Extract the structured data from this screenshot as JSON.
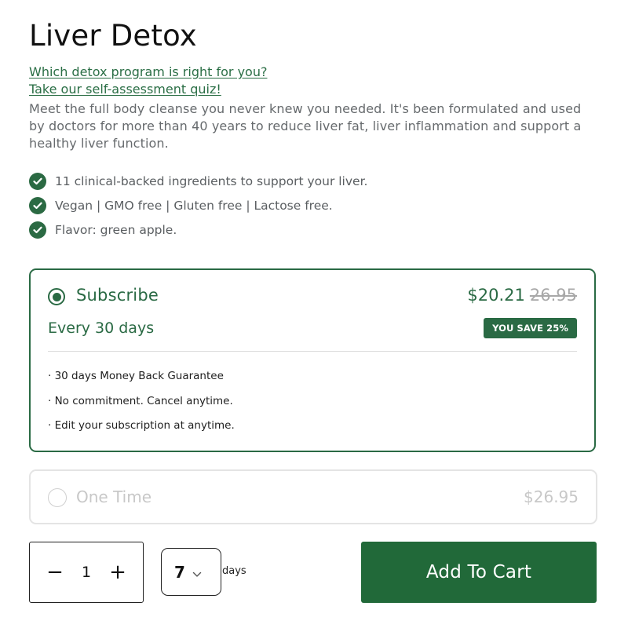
{
  "product": {
    "title": "Liver Detox",
    "quiz_link_1": "Which detox program is right for you?",
    "quiz_link_2": "Take our self-assessment quiz!",
    "description": "Meet the full body cleanse you never knew you needed. It's been formulated and used by doctors for more than 40 years to reduce liver fat, liver inflammation and support a healthy liver function.",
    "features": [
      "11 clinical-backed ingredients to support your liver.",
      "Vegan | GMO free | Gluten free | Lactose free.",
      "Flavor: green apple."
    ]
  },
  "plans": {
    "subscribe": {
      "label": "Subscribe",
      "price": "$20.21",
      "old_price": "26.95",
      "frequency": "Every 30 days",
      "badge": "YOU SAVE 25%",
      "selected": true,
      "perks": [
        "· 30 days Money Back Guarantee",
        "· No commitment. Cancel anytime.",
        "· Edit your subscription at anytime."
      ]
    },
    "one_time": {
      "label": "One Time",
      "price": "$26.95",
      "selected": false
    }
  },
  "purchase": {
    "quantity": "1",
    "decrement_label": "−",
    "increment_label": "+",
    "days_value": "7",
    "days_label": "days",
    "add_to_cart_label": "Add To Cart"
  },
  "colors": {
    "brand_green": "#2a6a44",
    "cart_button": "#216939",
    "muted_text": "#666a6d"
  },
  "icons": {
    "feature": "check-circle-icon",
    "select": "chevron-down-icon"
  }
}
